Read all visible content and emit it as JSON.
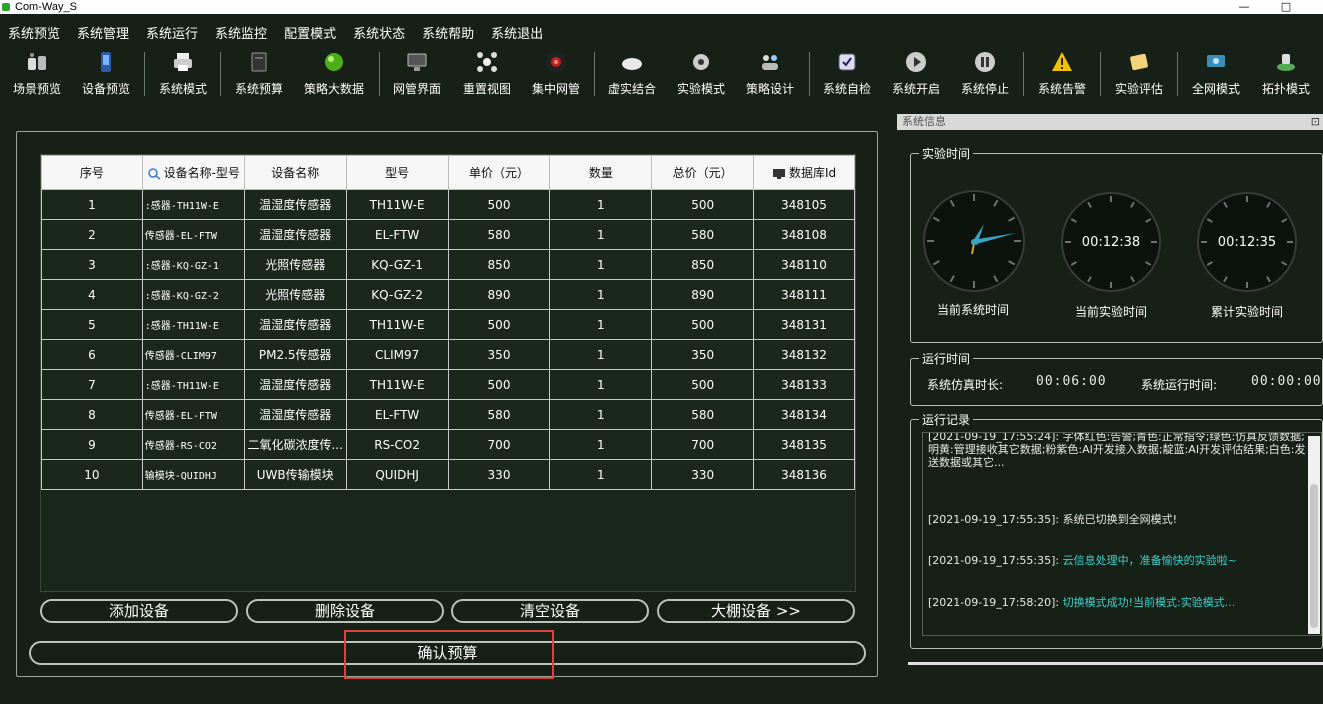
{
  "window": {
    "title": "Com-Way_S",
    "minimize": "—",
    "maximize": "□"
  },
  "menu": [
    "系统预览",
    "系统管理",
    "系统运行",
    "系统监控",
    "配置模式",
    "系统状态",
    "系统帮助",
    "系统退出"
  ],
  "toolbar": [
    {
      "label": "场景预览",
      "icon": "scene-icon"
    },
    {
      "label": "设备预览",
      "icon": "device-icon"
    },
    {
      "label": "系统模式",
      "icon": "printer-icon"
    },
    {
      "label": "系统预算",
      "icon": "book-icon"
    },
    {
      "label": "策略大数据",
      "icon": "globe-icon"
    },
    {
      "label": "网管界面",
      "icon": "monitor-icon"
    },
    {
      "label": "重置视图",
      "icon": "reset-icon"
    },
    {
      "label": "集中网管",
      "icon": "target-icon"
    },
    {
      "label": "虚实结合",
      "icon": "cloud-icon"
    },
    {
      "label": "实验模式",
      "icon": "gear-icon"
    },
    {
      "label": "策略设计",
      "icon": "users-icon"
    },
    {
      "label": "系统自检",
      "icon": "check-icon"
    },
    {
      "label": "系统开启",
      "icon": "play-icon"
    },
    {
      "label": "系统停止",
      "icon": "pause-icon"
    },
    {
      "label": "系统告警",
      "icon": "warning-icon"
    },
    {
      "label": "实验评估",
      "icon": "evaluate-icon"
    },
    {
      "label": "全网模式",
      "icon": "network-icon"
    },
    {
      "label": "拓扑模式",
      "icon": "topology-icon"
    }
  ],
  "table": {
    "headers": [
      "序号",
      "设备名称-型号",
      "设备名称",
      "型号",
      "单价（元）",
      "数量",
      "总价（元）",
      "数据库Id"
    ],
    "rows": [
      [
        "1",
        ":感器-TH11W-E",
        "温湿度传感器",
        "TH11W-E",
        "500",
        "1",
        "500",
        "348105"
      ],
      [
        "2",
        "传感器-EL-FTW",
        "温湿度传感器",
        "EL-FTW",
        "580",
        "1",
        "580",
        "348108"
      ],
      [
        "3",
        ":感器-KQ-GZ-1",
        "光照传感器",
        "KQ-GZ-1",
        "850",
        "1",
        "850",
        "348110"
      ],
      [
        "4",
        ":感器-KQ-GZ-2",
        "光照传感器",
        "KQ-GZ-2",
        "890",
        "1",
        "890",
        "348111"
      ],
      [
        "5",
        ":感器-TH11W-E",
        "温湿度传感器",
        "TH11W-E",
        "500",
        "1",
        "500",
        "348131"
      ],
      [
        "6",
        "传感器-CLIM97",
        "PM2.5传感器",
        "CLIM97",
        "350",
        "1",
        "350",
        "348132"
      ],
      [
        "7",
        ":感器-TH11W-E",
        "温湿度传感器",
        "TH11W-E",
        "500",
        "1",
        "500",
        "348133"
      ],
      [
        "8",
        "传感器-EL-FTW",
        "温湿度传感器",
        "EL-FTW",
        "580",
        "1",
        "580",
        "348134"
      ],
      [
        "9",
        "传感器-RS-CO2",
        "二氧化碳浓度传...",
        "RS-CO2",
        "700",
        "1",
        "700",
        "348135"
      ],
      [
        "10",
        "输模块-QUIDHJ",
        "UWB传输模块",
        "QUIDHJ",
        "330",
        "1",
        "330",
        "348136"
      ]
    ]
  },
  "actions": {
    "add": "添加设备",
    "delete": "删除设备",
    "clear": "清空设备",
    "greenhouse": "大棚设备 >>",
    "confirm": "确认预算"
  },
  "info": {
    "header": "系统信息",
    "pin": "⊡",
    "experiment_time": {
      "title": "实验时间",
      "system_clock_label": "当前系统时间",
      "current_label": "当前实验时间",
      "current_value": "00:12:38",
      "total_label": "累计实验时间",
      "total_value": "00:12:35"
    },
    "run_time": {
      "title": "运行时间",
      "sim_label": "系统仿真时长:",
      "sim_value": "00:06:00",
      "run_label": "系统运行时间:",
      "run_value": "00:00:00"
    },
    "log": {
      "title": "运行记录",
      "lines": [
        {
          "text": "[2021-09-19_17:55:24]: 字体红色:告警;青色:正常指令;绿色:仿真反馈数据;明黄:管理接收其它数据;粉紫色:AI开发接入数据;靛蓝:AI开发评估结果;白色:发送数据或其它...",
          "kind": "normal"
        },
        {
          "ts": "[2021-09-19_17:55:35]:",
          "text": " 系统已切换到全网模式!",
          "kind": "white"
        },
        {
          "ts": "[2021-09-19_17:55:35]:",
          "text": " 云信息处理中，准备愉快的实验啦~",
          "kind": "cyan"
        },
        {
          "ts": "[2021-09-19_17:58:20]:",
          "text": " 切换模式成功!当前模式:实验模式...",
          "kind": "cyan"
        }
      ]
    }
  },
  "colors": {
    "background": "#162016",
    "log_cyan": "#3fd2cc",
    "highlight": "#e04040"
  }
}
